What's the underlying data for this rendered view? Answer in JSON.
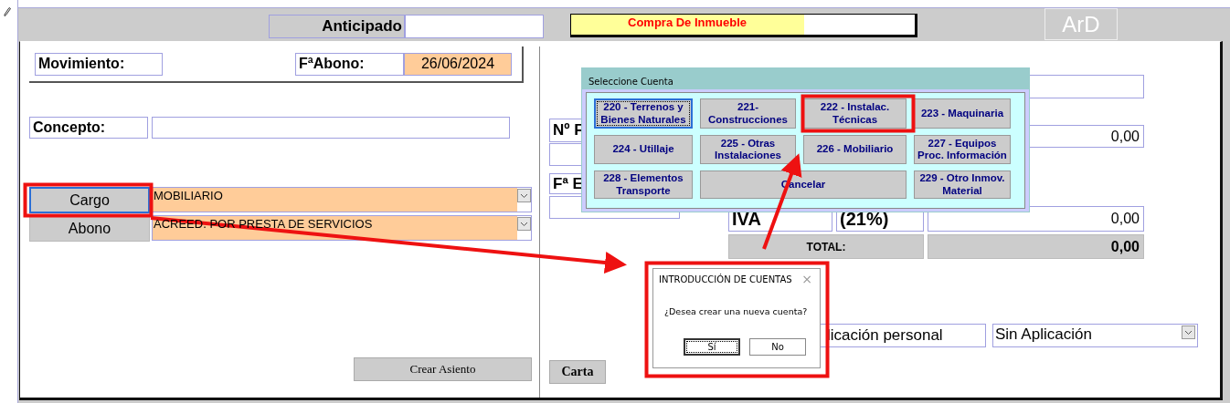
{
  "top_bar": {
    "advance_label": "Anticipado",
    "banner": "Compra De Inmueble",
    "badge": "ArD"
  },
  "movement": {
    "movement_label": "Movimiento:",
    "date_label": "FªAbono:",
    "date_value": "26/06/2024"
  },
  "concept": {
    "label": "Concepto:"
  },
  "accounts": [
    {
      "button": "Cargo",
      "value": "MOBILIARIO",
      "focused": true
    },
    {
      "button": "Abono",
      "value": "ACREED. POR PRESTA DE SERVICIOS",
      "focused": false
    }
  ],
  "create_button": "Crear Asiento",
  "right": {
    "number_label": "Nº F",
    "amount": "0,00",
    "date_label": "Fª E",
    "iva_label": "IVA",
    "iva_rate": "(21%)",
    "iva_amount": "0,00",
    "total_label": "TOTAL:",
    "total_amount": "0,00",
    "application_field": "licación personal",
    "application_select": "Sin Aplicación",
    "letter_button": "Carta"
  },
  "account_picker": {
    "title": "Seleccione Cuenta",
    "buttons": [
      {
        "kind": "account",
        "label": "220 - Terrenos y\nBienes Naturales",
        "focused": true
      },
      {
        "kind": "account",
        "label": "221-\nConstrucciones",
        "focused": false
      },
      {
        "kind": "account",
        "label": "222 - Instalac.\nTécnicas",
        "focused": false
      },
      {
        "kind": "account",
        "label": "223 - Maquinaria",
        "focused": false
      },
      {
        "kind": "account",
        "label": "224 - Utillaje",
        "focused": false
      },
      {
        "kind": "account",
        "label": "225 - Otras\nInstalaciones",
        "focused": false
      },
      {
        "kind": "account",
        "label": "226 - Mobiliario",
        "focused": false
      },
      {
        "kind": "account",
        "label": "227 - Equipos\nProc. Información",
        "focused": false
      },
      {
        "kind": "account",
        "label": "228 - Elementos\nTransporte",
        "focused": false
      },
      {
        "kind": "cancel",
        "label": "Cancelar",
        "focused": false
      },
      {
        "kind": "account",
        "label": "229 - Otro Inmov.\nMaterial",
        "focused": false
      }
    ]
  },
  "dialog": {
    "title": "INTRODUCCIÓN DE CUENTAS",
    "close": "×",
    "message": "¿Desea crear una nueva cuenta?",
    "buttons": [
      {
        "label": "Sí",
        "focused": true
      },
      {
        "label": "No",
        "focused": false
      }
    ]
  }
}
